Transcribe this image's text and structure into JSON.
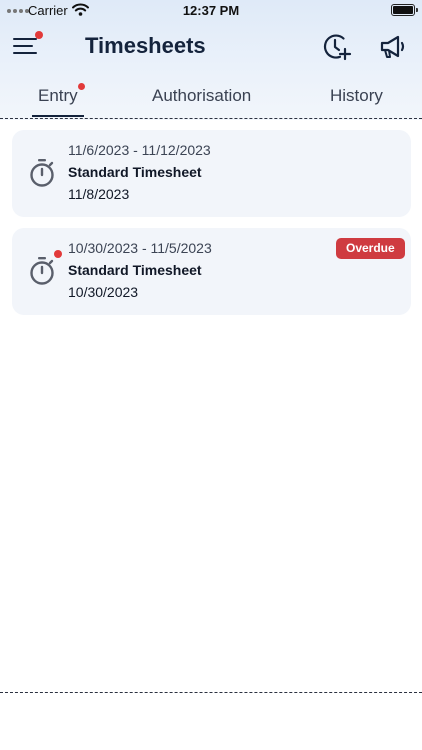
{
  "status_bar": {
    "carrier": "Carrier",
    "time": "12:37 PM"
  },
  "header": {
    "title": "Timesheets",
    "icons": {
      "menu": "hamburger-menu-icon",
      "add_time": "clock-plus-icon",
      "announcements": "megaphone-icon"
    },
    "colors": {
      "notification_dot": "#e23a3a",
      "title": "#14233c"
    }
  },
  "tabs": [
    {
      "label": "Entry",
      "active": true,
      "has_notification": true
    },
    {
      "label": "Authorisation",
      "active": false
    },
    {
      "label": "History",
      "active": false
    }
  ],
  "timesheets": [
    {
      "range": "11/6/2023 - 11/12/2023",
      "type": "Standard Timesheet",
      "date": "11/8/2023",
      "icon": "stopwatch-icon",
      "overdue": false
    },
    {
      "range": "10/30/2023 - 11/5/2023",
      "type": "Standard Timesheet",
      "date": "10/30/2023",
      "icon": "stopwatch-icon",
      "overdue": true,
      "badge": "Overdue",
      "badge_color": "#cf3b40"
    }
  ]
}
